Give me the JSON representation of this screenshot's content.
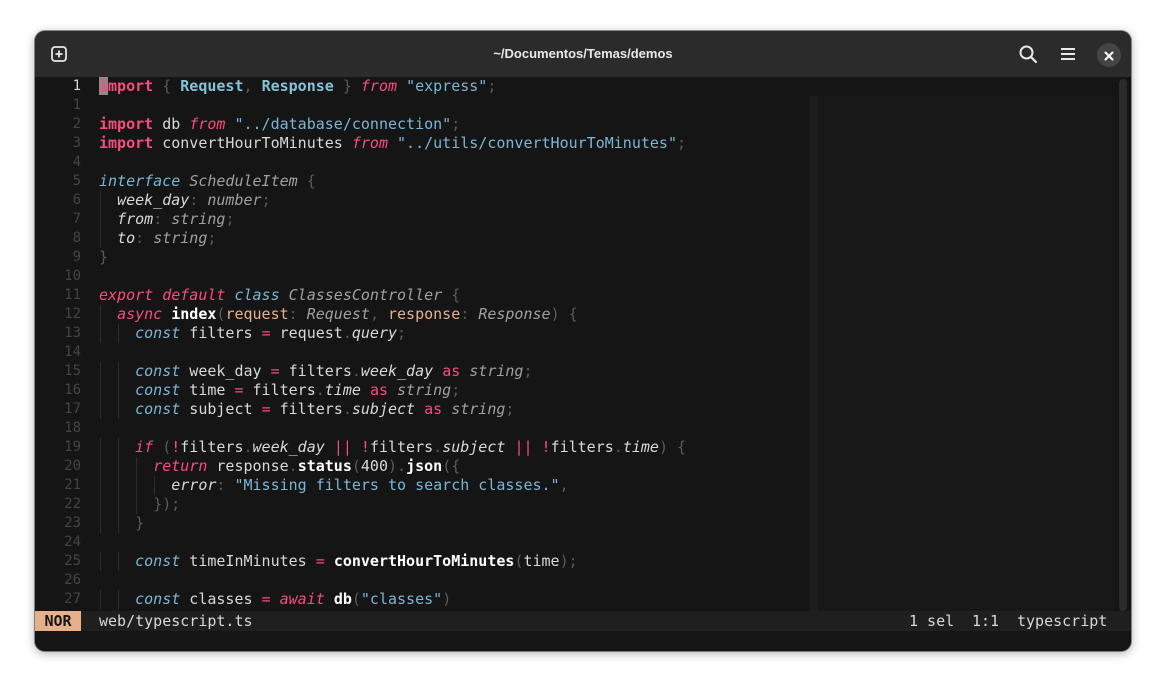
{
  "window": {
    "title": "~/Documentos/Temas/demos"
  },
  "icons": {
    "new_tab": "new-tab-icon",
    "search": "search-icon",
    "menu": "hamburger-menu-icon",
    "close": "close-icon"
  },
  "colors": {
    "keyword": "#fa4c7c",
    "string": "#7ab6d6",
    "param": "#e6b18a",
    "mode_bg": "#e6b18a",
    "background": "#151515"
  },
  "editor": {
    "line_numbers": [
      "1",
      "1",
      "2",
      "3",
      "4",
      "5",
      "6",
      "7",
      "8",
      "9",
      "10",
      "11",
      "12",
      "13",
      "14",
      "15",
      "16",
      "17",
      "18",
      "19",
      "20",
      "21",
      "22",
      "23",
      "24",
      "25",
      "26",
      "27"
    ],
    "lines": [
      [
        [
          "",
          "i",
          "kw cursor"
        ],
        [
          "mport",
          "",
          "kw"
        ],
        [
          " { ",
          "",
          "dm"
        ],
        [
          "Request",
          "",
          "im"
        ],
        [
          ", ",
          "",
          "dm"
        ],
        [
          "Response",
          "",
          "im"
        ],
        [
          " } ",
          "",
          "dm"
        ],
        [
          "from",
          "",
          "kwi"
        ],
        [
          " ",
          "",
          ""
        ],
        [
          "\"express\"",
          "",
          "st"
        ],
        [
          ";",
          "",
          "dm"
        ]
      ],
      [],
      [
        [
          "import",
          "",
          "kw"
        ],
        [
          " db ",
          "",
          ""
        ],
        [
          "from",
          "",
          "kwi"
        ],
        [
          " ",
          "",
          ""
        ],
        [
          "\"../database/connection\"",
          "",
          "st"
        ],
        [
          ";",
          "",
          "dm"
        ]
      ],
      [
        [
          "import",
          "",
          "kw"
        ],
        [
          " convertHourToMinutes ",
          "",
          ""
        ],
        [
          "from",
          "",
          "kwi"
        ],
        [
          " ",
          "",
          ""
        ],
        [
          "\"../utils/convertHourToMinutes\"",
          "",
          "st"
        ],
        [
          ";",
          "",
          "dm"
        ]
      ],
      [],
      [
        [
          "interface",
          "",
          "tl"
        ],
        [
          " ",
          "",
          ""
        ],
        [
          "ScheduleItem",
          "",
          "ty"
        ],
        [
          " {",
          "",
          "dm"
        ]
      ],
      [
        [
          "  ",
          "",
          ""
        ],
        [
          "week_day",
          "",
          "ob"
        ],
        [
          ": ",
          "",
          "dm"
        ],
        [
          "number",
          "",
          "ty"
        ],
        [
          ";",
          "",
          "dm"
        ]
      ],
      [
        [
          "  ",
          "",
          ""
        ],
        [
          "from",
          "",
          "ob"
        ],
        [
          ": ",
          "",
          "dm"
        ],
        [
          "string",
          "",
          "ty"
        ],
        [
          ";",
          "",
          "dm"
        ]
      ],
      [
        [
          "  ",
          "",
          ""
        ],
        [
          "to",
          "",
          "ob"
        ],
        [
          ": ",
          "",
          "dm"
        ],
        [
          "string",
          "",
          "ty"
        ],
        [
          ";",
          "",
          "dm"
        ]
      ],
      [
        [
          "}",
          "",
          "dm"
        ]
      ],
      [],
      [
        [
          "export",
          "",
          "kwi"
        ],
        [
          " ",
          "",
          ""
        ],
        [
          "default",
          "",
          "kwi"
        ],
        [
          " ",
          "",
          ""
        ],
        [
          "class",
          "",
          "tl"
        ],
        [
          " ",
          "",
          ""
        ],
        [
          "ClassesController",
          "",
          "ty"
        ],
        [
          " {",
          "",
          "dm"
        ]
      ],
      [
        [
          "  ",
          "",
          ""
        ],
        [
          "async",
          "",
          "kwi"
        ],
        [
          " ",
          "",
          ""
        ],
        [
          "index",
          "",
          "fn"
        ],
        [
          "(",
          "",
          "dm"
        ],
        [
          "request",
          "",
          "pa"
        ],
        [
          ": ",
          "",
          "dm"
        ],
        [
          "Request",
          "",
          "ty"
        ],
        [
          ", ",
          "",
          "dm"
        ],
        [
          "response",
          "",
          "pa"
        ],
        [
          ": ",
          "",
          "dm"
        ],
        [
          "Response",
          "",
          "ty"
        ],
        [
          ") {",
          "",
          "dm"
        ]
      ],
      [
        [
          "    ",
          "",
          ""
        ],
        [
          "const",
          "",
          "tl"
        ],
        [
          " filters ",
          "",
          ""
        ],
        [
          "=",
          "",
          "op"
        ],
        [
          " request",
          "",
          ""
        ],
        [
          ".",
          "",
          "dm"
        ],
        [
          "query",
          "",
          "ob"
        ],
        [
          ";",
          "",
          "dm"
        ]
      ],
      [],
      [
        [
          "    ",
          "",
          ""
        ],
        [
          "const",
          "",
          "tl"
        ],
        [
          " week_day ",
          "",
          ""
        ],
        [
          "=",
          "",
          "op"
        ],
        [
          " filters",
          "",
          ""
        ],
        [
          ".",
          "",
          "dm"
        ],
        [
          "week_day",
          "",
          "ob"
        ],
        [
          " ",
          "",
          ""
        ],
        [
          "as",
          "",
          "op"
        ],
        [
          " ",
          "",
          ""
        ],
        [
          "string",
          "",
          "ty"
        ],
        [
          ";",
          "",
          "dm"
        ]
      ],
      [
        [
          "    ",
          "",
          ""
        ],
        [
          "const",
          "",
          "tl"
        ],
        [
          " time ",
          "",
          ""
        ],
        [
          "=",
          "",
          "op"
        ],
        [
          " filters",
          "",
          ""
        ],
        [
          ".",
          "",
          "dm"
        ],
        [
          "time",
          "",
          "ob"
        ],
        [
          " ",
          "",
          ""
        ],
        [
          "as",
          "",
          "op"
        ],
        [
          " ",
          "",
          ""
        ],
        [
          "string",
          "",
          "ty"
        ],
        [
          ";",
          "",
          "dm"
        ]
      ],
      [
        [
          "    ",
          "",
          ""
        ],
        [
          "const",
          "",
          "tl"
        ],
        [
          " subject ",
          "",
          ""
        ],
        [
          "=",
          "",
          "op"
        ],
        [
          " filters",
          "",
          ""
        ],
        [
          ".",
          "",
          "dm"
        ],
        [
          "subject",
          "",
          "ob"
        ],
        [
          " ",
          "",
          ""
        ],
        [
          "as",
          "",
          "op"
        ],
        [
          " ",
          "",
          ""
        ],
        [
          "string",
          "",
          "ty"
        ],
        [
          ";",
          "",
          "dm"
        ]
      ],
      [],
      [
        [
          "    ",
          "",
          ""
        ],
        [
          "if",
          "",
          "kwi"
        ],
        [
          " (",
          "",
          "dm"
        ],
        [
          "!",
          "",
          "op"
        ],
        [
          "filters",
          "",
          ""
        ],
        [
          ".",
          "",
          "dm"
        ],
        [
          "week_day",
          "",
          "ob"
        ],
        [
          " ",
          "",
          ""
        ],
        [
          "||",
          "",
          "op"
        ],
        [
          " ",
          "",
          ""
        ],
        [
          "!",
          "",
          "op"
        ],
        [
          "filters",
          "",
          ""
        ],
        [
          ".",
          "",
          "dm"
        ],
        [
          "subject",
          "",
          "ob"
        ],
        [
          " ",
          "",
          ""
        ],
        [
          "||",
          "",
          "op"
        ],
        [
          " ",
          "",
          ""
        ],
        [
          "!",
          "",
          "op"
        ],
        [
          "filters",
          "",
          ""
        ],
        [
          ".",
          "",
          "dm"
        ],
        [
          "time",
          "",
          "ob"
        ],
        [
          ") {",
          "",
          "dm"
        ]
      ],
      [
        [
          "      ",
          "",
          ""
        ],
        [
          "return",
          "",
          "kwi"
        ],
        [
          " response",
          "",
          ""
        ],
        [
          ".",
          "",
          "dm"
        ],
        [
          "status",
          "",
          "fn"
        ],
        [
          "(",
          "",
          "dm"
        ],
        [
          "400",
          "",
          ""
        ],
        [
          ")",
          "",
          "dm"
        ],
        [
          ".",
          "",
          "dm"
        ],
        [
          "json",
          "",
          "fn"
        ],
        [
          "({",
          "",
          "dm"
        ]
      ],
      [
        [
          "        ",
          "",
          ""
        ],
        [
          "error",
          "",
          "ob"
        ],
        [
          ": ",
          "",
          "dm"
        ],
        [
          "\"Missing filters to search classes.\"",
          "",
          "st"
        ],
        [
          ",",
          "",
          "dm"
        ]
      ],
      [
        [
          "      ",
          "",
          ""
        ],
        [
          "});",
          "",
          "dm"
        ]
      ],
      [
        [
          "    ",
          "",
          ""
        ],
        [
          "}",
          "",
          "dm"
        ]
      ],
      [],
      [
        [
          "    ",
          "",
          ""
        ],
        [
          "const",
          "",
          "tl"
        ],
        [
          " timeInMinutes ",
          "",
          ""
        ],
        [
          "=",
          "",
          "op"
        ],
        [
          " ",
          "",
          ""
        ],
        [
          "convertHourToMinutes",
          "",
          "fn"
        ],
        [
          "(",
          "",
          "dm"
        ],
        [
          "time",
          "",
          ""
        ],
        [
          ");",
          "",
          "dm"
        ]
      ],
      [],
      [
        [
          "    ",
          "",
          ""
        ],
        [
          "const",
          "",
          "tl"
        ],
        [
          " classes ",
          "",
          ""
        ],
        [
          "=",
          "",
          "op"
        ],
        [
          " ",
          "",
          ""
        ],
        [
          "await",
          "",
          "kwi"
        ],
        [
          " ",
          "",
          ""
        ],
        [
          "db",
          "",
          "fn"
        ],
        [
          "(",
          "",
          "dm"
        ],
        [
          "\"classes\"",
          "",
          "st"
        ],
        [
          ")",
          "",
          "dm"
        ]
      ]
    ]
  },
  "statusbar": {
    "mode": "NOR",
    "file": "web/typescript.ts",
    "selections": "1 sel",
    "position": "1:1",
    "language": "typescript"
  }
}
